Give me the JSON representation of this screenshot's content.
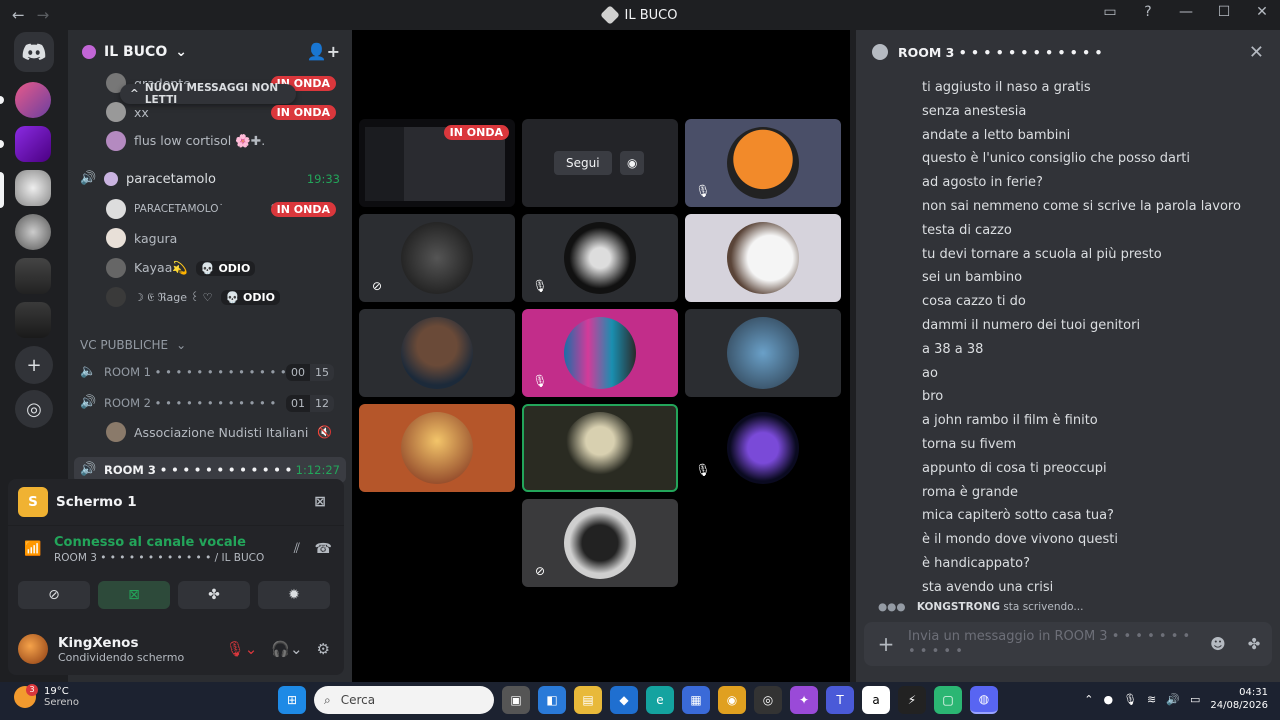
{
  "titlebar": {
    "title": "IL BUCO",
    "back": "←",
    "forward": "→"
  },
  "server": {
    "name": "IL BUCO"
  },
  "new_messages_label": "NUOVI MESSAGGI NON LETTI",
  "members_top": [
    {
      "name": "gradente",
      "live": "IN ONDA"
    },
    {
      "name": "xx",
      "live": "IN ONDA"
    },
    {
      "name": "flus low cortisol 🌸✚."
    }
  ],
  "vc_room_paracetamolo": {
    "name": "paracetamolo",
    "time": "19:33"
  },
  "members_paracetamolo": [
    {
      "name": "PARACETAMOLO˙",
      "live": "IN ONDA"
    },
    {
      "name": "kagura"
    },
    {
      "name": "Kayaa💫",
      "badge": "💀 ODIO"
    },
    {
      "name": "☽ 𝔈 ℜage ꒰ ♡",
      "badge": "💀 ODIO"
    }
  ],
  "category": "VC PUBBLICHE",
  "rooms": [
    {
      "name": "ROOM 1 • • • • • • • • • • • • • • •",
      "count_a": "00",
      "count_b": "15"
    },
    {
      "name": "ROOM 2 • • • • • • • • • • • •",
      "count_a": "01",
      "count_b": "12"
    }
  ],
  "room2_member": "Associazione Nudisti Italiani",
  "room3": {
    "name": "ROOM 3 • • • • • • • • • • • •",
    "time": "1:12:27"
  },
  "share": {
    "icon_letter": "S",
    "label": "Schermo 1"
  },
  "voice": {
    "status": "Connesso al canale vocale",
    "channel": "ROOM 3 • • • • • • • • • • • • / IL BUCO"
  },
  "user": {
    "name": "KingXenos",
    "status": "Condividendo schermo"
  },
  "stage": {
    "live_label": "IN ONDA",
    "follow_label": "Segui"
  },
  "chat": {
    "title": "ROOM 3 • • • • • • • • • • • •",
    "messages": [
      "ti aggiusto il naso a gratis",
      "senza anestesia",
      "andate a letto bambini",
      "questo è l'unico consiglio che posso darti",
      "ad agosto in ferie?",
      "non sai nemmeno come si scrive la parola lavoro",
      "testa di cazzo",
      "tu devi tornare a scuola al più presto",
      "sei un bambino",
      "cosa cazzo ti do",
      "dammi il numero dei tuoi genitori",
      "a 38 a 38",
      "ao",
      "bro",
      "a john rambo il film è finito",
      "torna su fivem",
      "appunto di cosa ti preoccupi",
      "roma è grande",
      "mica capiterò sotto casa tua?",
      "è il mondo dove vivono questi",
      "è handicappato?",
      "sta avendo una crisi"
    ],
    "typing_user": "KONGSTRONG",
    "typing_text": "sta scrivendo...",
    "placeholder": "Invia un messaggio in ROOM 3 • • • • • • • • • • • •"
  },
  "taskbar": {
    "weather_badge": "3",
    "temp": "19°C",
    "condition": "Sereno",
    "search": "Cerca",
    "time": "04:31",
    "date": "24/08/2026"
  },
  "colors": {
    "green": "#23a55a",
    "red": "#da373c",
    "blurple": "#5865f2"
  }
}
